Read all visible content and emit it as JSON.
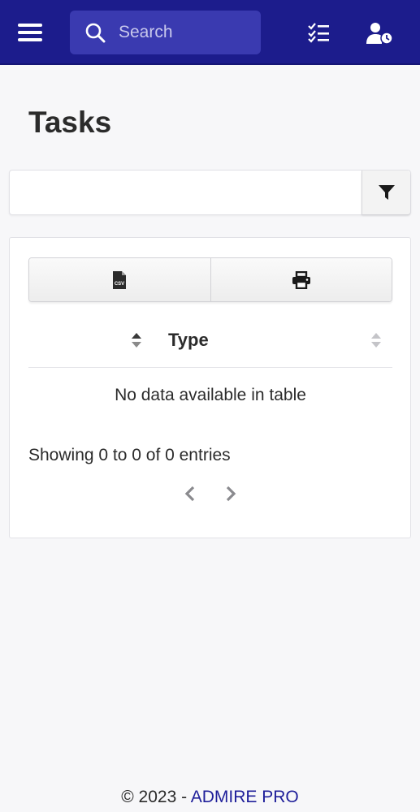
{
  "colors": {
    "topbar": "#1c1c8c",
    "search_bg": "#3a3ab0",
    "brand_link": "#1f1f9a"
  },
  "header": {
    "menu_icon": "hamburger-menu-icon",
    "search": {
      "placeholder": "Search",
      "value": "",
      "icon": "search-icon"
    },
    "tasks_icon": "task-list-icon",
    "user_icon": "user-clock-icon"
  },
  "page": {
    "title": "Tasks"
  },
  "filter": {
    "value": "",
    "button_icon": "filter-icon"
  },
  "table": {
    "export_buttons": [
      {
        "icon": "csv-file-icon",
        "label": "CSV"
      },
      {
        "icon": "printer-icon"
      }
    ],
    "columns": [
      {
        "label": "Type"
      }
    ],
    "empty_message": "No data available in table",
    "info": "Showing 0 to 0 of 0 entries",
    "pager": {
      "prev_icon": "chevron-left-icon",
      "next_icon": "chevron-right-icon"
    }
  },
  "footer": {
    "copyright": "© 2023 - ",
    "brand": "ADMIRE PRO"
  }
}
